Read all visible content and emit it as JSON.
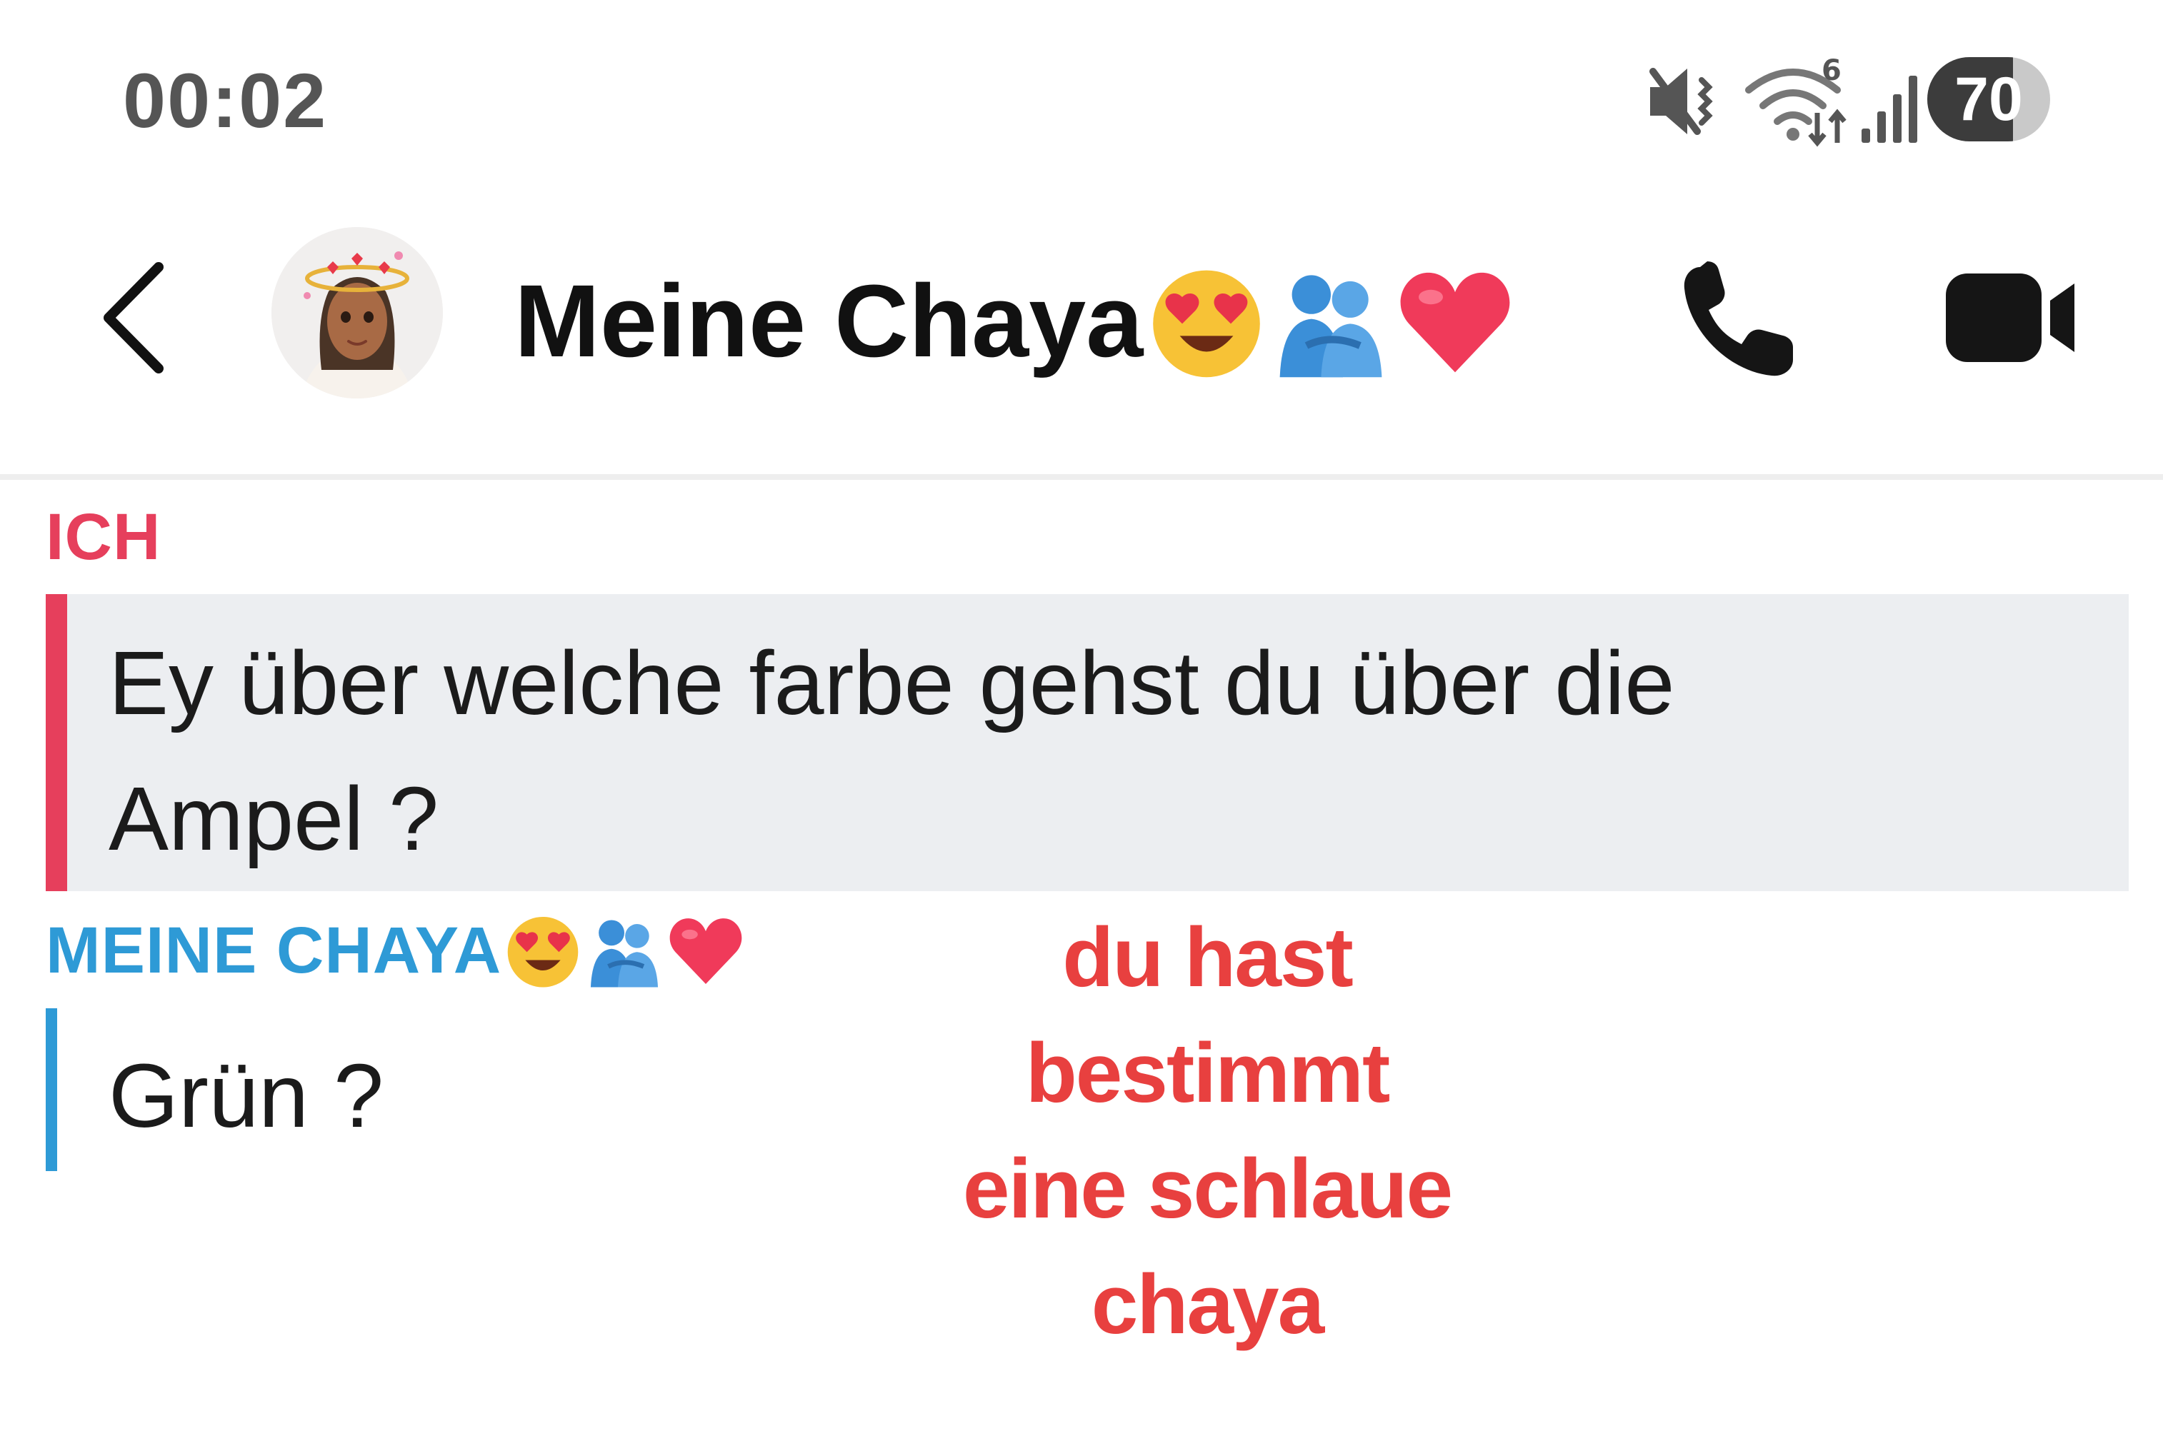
{
  "status_bar": {
    "time": "00:02",
    "battery_level": "70",
    "icons": [
      "mute-vibrate-icon",
      "wifi-6-icon",
      "signal-icon",
      "battery-icon"
    ]
  },
  "header": {
    "title": "Meine Chaya",
    "title_emojis": [
      "heart-eyes-emoji",
      "hugging-people-emoji",
      "red-heart-emoji"
    ],
    "icons": [
      "back-chevron-icon",
      "phone-icon",
      "video-camera-icon"
    ]
  },
  "messages": [
    {
      "sender": "ICH",
      "lines": [
        "Ey über welche farbe gehst du über die",
        "Ampel ?"
      ]
    },
    {
      "sender": "MEINE CHAYA",
      "sender_emojis": [
        "heart-eyes-emoji",
        "hugging-people-emoji",
        "red-heart-emoji"
      ],
      "lines": [
        "Grün ?"
      ]
    }
  ],
  "overlay": {
    "lines": [
      "du hast",
      "bestimmt",
      "eine schlaue",
      "chaya"
    ]
  },
  "colors": {
    "me_accent": "#e63f5c",
    "other_accent": "#2e9ad6",
    "overlay_text": "#e8403f",
    "message_bg": "#eceef1"
  }
}
